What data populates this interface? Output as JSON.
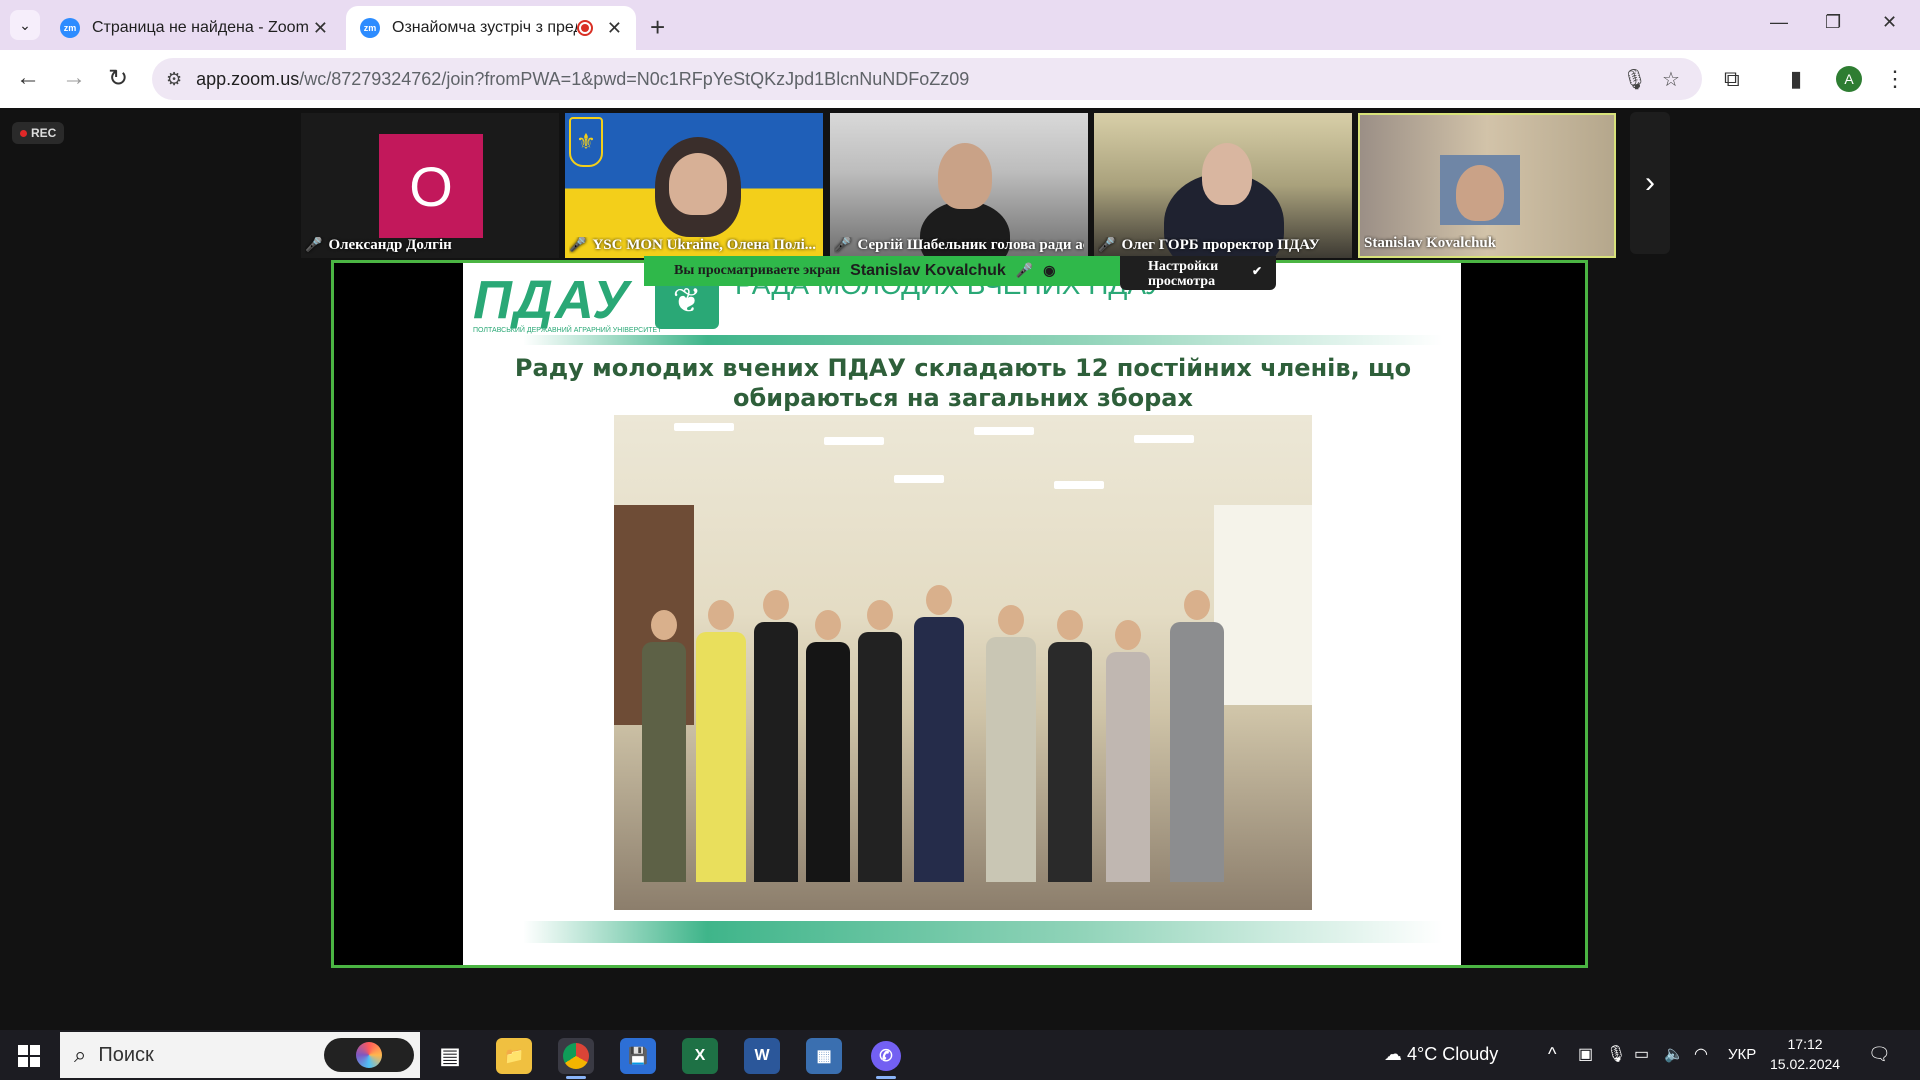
{
  "browser": {
    "tabs": [
      {
        "title": "Страница не найдена - Zoom",
        "favicon": "zm"
      },
      {
        "title": "Ознайомча зустріч з пред",
        "favicon": "zm"
      }
    ],
    "url_host": "app.zoom.us",
    "url_path": "/wc/87279324762/join?fromPWA=1&pwd=N0c1RFpYeStQKzJpd1BlcnNuNDFoZz09",
    "profile_initial": "A"
  },
  "zoom": {
    "rec_label": "REC",
    "participants": [
      {
        "name": "Олександр Долгін",
        "initial": "О"
      },
      {
        "name": "YSC MON Ukraine, Олена Полі..."
      },
      {
        "name": "Сергій Шабельник голова ради ас..."
      },
      {
        "name": "Олег ГОРБ проректор ПДАУ"
      },
      {
        "name": "Stanislav Kovalchuk"
      }
    ],
    "share_banner": {
      "prefix": "Вы просматриваете экран",
      "sharer": "Stanislav Kovalchuk"
    },
    "view_options_label": "Настройки просмотра",
    "slide": {
      "logo_text": "ПДАУ",
      "logo_subtext": "ПОЛТАВСЬКИЙ ДЕРЖАВНИЙ АГРАРНИЙ УНІВЕРСИТЕТ",
      "header": "РАДА МОЛОДИХ ВЧЕНИХ ПДАУ",
      "title": "Раду молодих вчених ПДАУ складають 12 постійних членів, що обираються на загальних зборах"
    }
  },
  "taskbar": {
    "search_placeholder": "Поиск",
    "weather": "4°C  Cloudy",
    "language": "УКР",
    "time": "17:12",
    "date": "15.02.2024"
  },
  "colors": {
    "accent_green": "#4bb543",
    "slide_green": "#2aa876",
    "tab_bar": "#e9dcf2"
  }
}
